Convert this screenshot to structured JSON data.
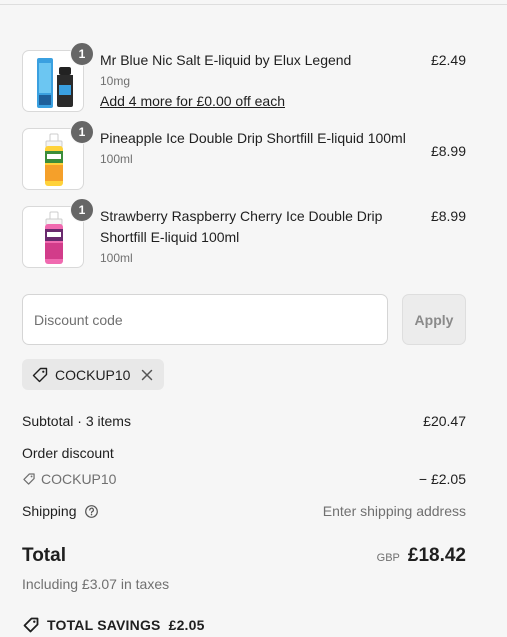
{
  "items": [
    {
      "name": "Mr Blue Nic Salt E-liquid by Elux Legend",
      "variant": "10mg",
      "upsell": "Add 4 more for £0.00 off each",
      "price": "£2.49",
      "quantity": "1",
      "thumb": "blue-bottle"
    },
    {
      "name": "Pineapple Ice Double Drip Shortfill E-liquid 100ml",
      "variant": "100ml",
      "price": "£8.99",
      "quantity": "1",
      "thumb": "orange-bottle"
    },
    {
      "name": "Strawberry Raspberry Cherry Ice Double Drip Shortfill E-liquid 100ml",
      "variant": "100ml",
      "price": "£8.99",
      "quantity": "1",
      "thumb": "pink-bottle"
    }
  ],
  "discount": {
    "placeholder": "Discount code",
    "apply_label": "Apply",
    "applied_code": "COCKUP10"
  },
  "summary": {
    "subtotal_label": "Subtotal · 3 items",
    "subtotal_value": "£20.47",
    "order_discount_label": "Order discount",
    "discount_code": "COCKUP10",
    "discount_value": "− £2.05",
    "shipping_label": "Shipping",
    "shipping_value": "Enter shipping address",
    "total_label": "Total",
    "currency": "GBP",
    "total_value": "£18.42",
    "taxes": "Including £3.07 in taxes",
    "savings_label": "TOTAL SAVINGS",
    "savings_value": "£2.05"
  },
  "colors": {
    "background": "#f6f6f6",
    "badge": "#666666",
    "tag_bg": "#e8e8e8"
  }
}
